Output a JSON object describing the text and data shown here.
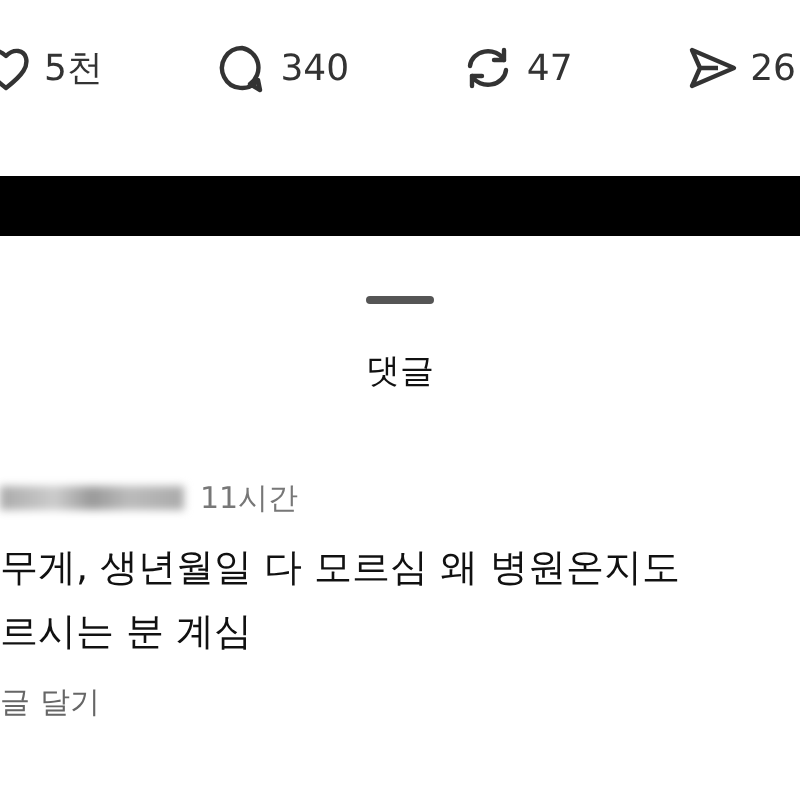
{
  "actions": [
    {
      "kind": "like",
      "count": "5천"
    },
    {
      "kind": "comment",
      "count": "340"
    },
    {
      "kind": "repost",
      "count": "47"
    },
    {
      "kind": "share",
      "count": "26"
    }
  ],
  "sheet": {
    "title": "댓글"
  },
  "comment": {
    "username_redacted": true,
    "time": "11시간",
    "lines": [
      "무게, 생년월일 다 모르심 왜 병원온지도",
      "르시는 분 계심"
    ],
    "reply": "글 달기"
  }
}
